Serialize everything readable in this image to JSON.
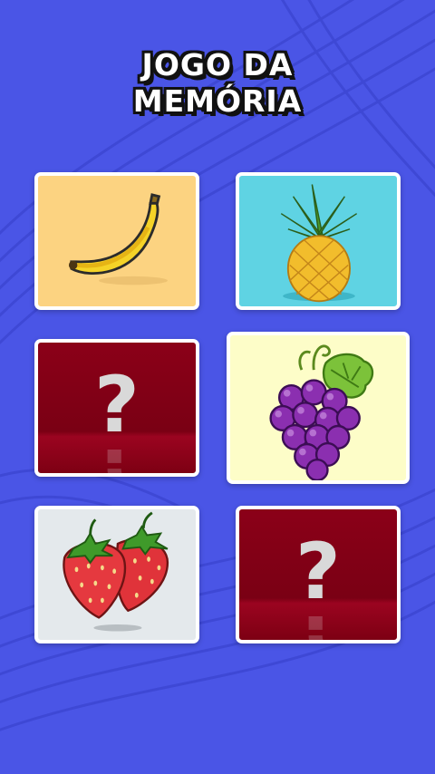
{
  "title": {
    "line1": "JOGO DA",
    "line2": "MEMÓRIA"
  },
  "cards": [
    {
      "state": "revealed",
      "fruit": "banana-icon",
      "background": "#fcd381"
    },
    {
      "state": "revealed",
      "fruit": "pineapple-icon",
      "background": "#5fd3e3"
    },
    {
      "state": "hidden",
      "symbol": "?",
      "background": "#8b0018"
    },
    {
      "state": "revealed",
      "fruit": "grapes-icon",
      "background": "#fdfdc8"
    },
    {
      "state": "revealed",
      "fruit": "strawberries-icon",
      "background": "#e4e9ec"
    },
    {
      "state": "hidden",
      "symbol": "?",
      "background": "#8b0018"
    }
  ],
  "colors": {
    "background": "#4a55e6",
    "card_border": "#ffffff",
    "hidden_card": "#8b0018"
  }
}
